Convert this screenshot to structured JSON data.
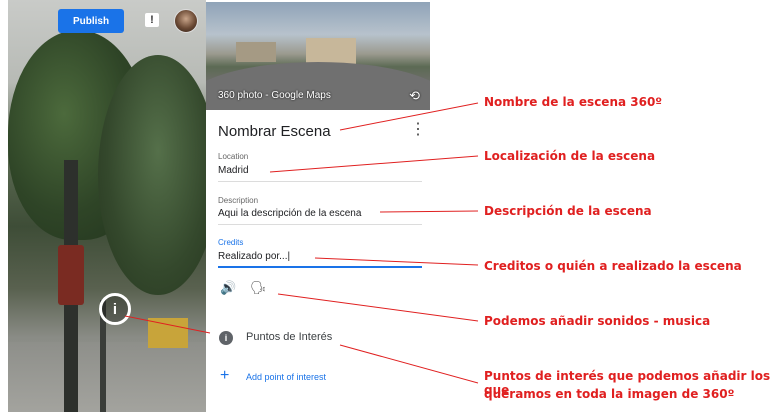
{
  "toolbar": {
    "publish_label": "Publish",
    "feedback_icon": "!"
  },
  "street_view": {
    "info_marker": "i"
  },
  "preview": {
    "caption": "360 photo - Google Maps"
  },
  "scene": {
    "title": "Nombrar Escena",
    "fields": {
      "location": {
        "label": "Location",
        "value": "Madrid"
      },
      "description": {
        "label": "Description",
        "value": "Aqui la descripción de la escena"
      },
      "credits": {
        "label": "Credits",
        "value": "Realizado por...|"
      }
    },
    "points_of_interest_label": "Puntos de Interés",
    "add_poi_label": "Add point of interest"
  },
  "annotations": {
    "name": "Nombre de la escena 360º",
    "location": "Localización de la escena",
    "description": "Descripción de la escena",
    "credits": "Creditos o quién a realizado la escena",
    "sounds": "Podemos añadir sonidos - musica",
    "poi_line1": "Puntos de interés que podemos añadir los que",
    "poi_line2": "queramos en toda la imagen de 360º"
  },
  "colors": {
    "accent": "#1a73e8",
    "annotation": "#e02020"
  },
  "icons": [
    "feedback-icon",
    "avatar",
    "info-icon",
    "rotate-icon",
    "more-vert-icon",
    "volume-icon",
    "voice-icon",
    "add-icon"
  ]
}
